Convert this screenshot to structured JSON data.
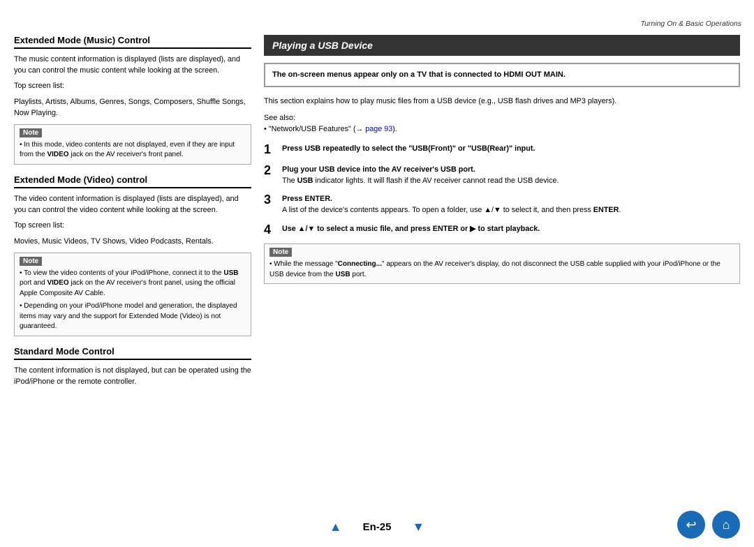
{
  "header": {
    "chapter_title": "Turning On & Basic Operations"
  },
  "left_column": {
    "section1": {
      "title": "Extended Mode (Music) Control",
      "body1": "The music content information is displayed (lists are displayed), and you can control the music content while looking at the screen.",
      "top_screen_label": "Top screen list:",
      "top_screen_items": "Playlists, Artists, Albums, Genres, Songs, Composers, Shuffle Songs, Now Playing.",
      "note": {
        "label": "Note",
        "text": "In this mode, video contents are not displayed, even if they are input from the VIDEO jack on the AV receiver's front panel."
      }
    },
    "section2": {
      "title": "Extended Mode (Video) control",
      "body1": "The video content information is displayed (lists are displayed), and you can control the video content while looking at the screen.",
      "top_screen_label": "Top screen list:",
      "top_screen_items": "Movies, Music Videos, TV Shows, Video Podcasts, Rentals.",
      "note": {
        "label": "Note",
        "bullets": [
          "To view the video contents of your iPod/iPhone, connect it to the USB port and VIDEO jack on the AV receiver's front panel, using the official Apple Composite AV Cable.",
          "Depending on your iPod/iPhone model and generation, the displayed items may vary and the support for Extended Mode (Video) is not guaranteed."
        ]
      }
    },
    "section3": {
      "title": "Standard Mode Control",
      "body1": "The content information is not displayed, but can be operated using the iPod/iPhone or the remote controller."
    }
  },
  "right_column": {
    "playing_title": "Playing a USB Device",
    "hdmi_note": {
      "text": "The on-screen menus appear only on a TV that is connected to HDMI OUT MAIN."
    },
    "intro": {
      "line1": "This section explains how to play music files from a USB device (e.g., USB flash drives and MP3 players).",
      "see_also_label": "See also:",
      "see_also_link": "“Network/USB Features” (→ page 93)."
    },
    "steps": [
      {
        "number": "1",
        "heading": "Press USB repeatedly to select the “USB(Front)” or “USB(Rear)” input."
      },
      {
        "number": "2",
        "heading": "Plug your USB device into the AV receiver’s USB port.",
        "detail": "The USB indicator lights. It will flash if the AV receiver cannot read the USB device."
      },
      {
        "number": "3",
        "heading": "Press ENTER.",
        "detail": "A list of the device’s contents appears. To open a folder, use ▲/▼ to select it, and then press ENTER."
      },
      {
        "number": "4",
        "heading": "Use ▲/▼ to select a music file, and press ENTER or ► to start playback."
      }
    ],
    "note": {
      "label": "Note",
      "text": "While the message “Connecting...” appears on the AV receiver’s display, do not disconnect the USB cable supplied with your iPod/iPhone or the USB device from the USB port."
    }
  },
  "footer": {
    "prev_arrow": "▲",
    "page_label": "En-25",
    "next_arrow": "▼",
    "back_icon": "↺",
    "home_icon": "⌂"
  }
}
